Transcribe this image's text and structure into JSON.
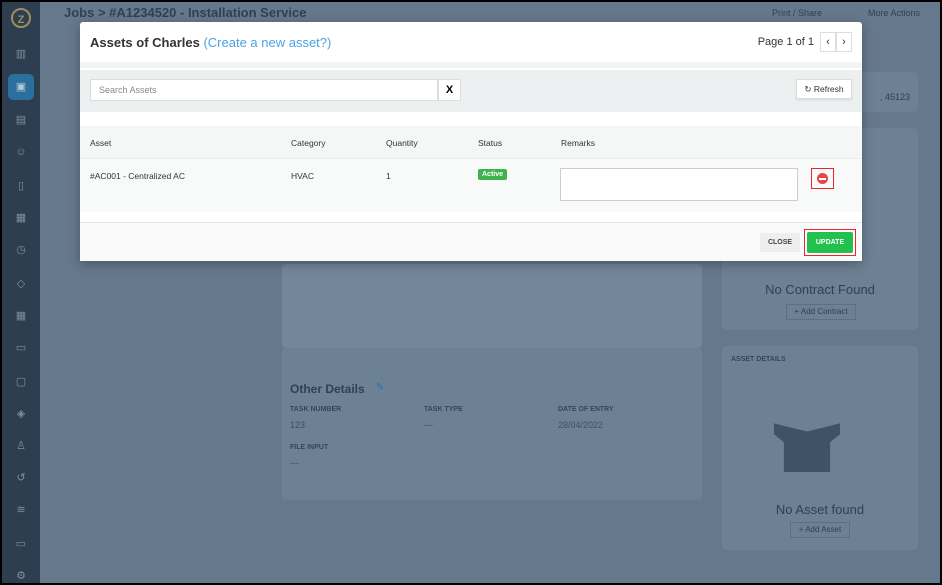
{
  "background": {
    "breadcrumb": "Jobs > #A1234520 - Installation Service",
    "print_share": "Print / Share",
    "more_actions": "More Actions",
    "address_fragment": ", 45123",
    "no_contract": "No Contract Found",
    "add_contract": "+ Add Contract",
    "asset_details_title": "ASSET DETAILS",
    "no_asset": "No Asset found",
    "add_asset": "+ Add Asset",
    "other_details": {
      "title": "Other Details",
      "fields": [
        {
          "label": "TASK NUMBER",
          "value": "123"
        },
        {
          "label": "TASK TYPE",
          "value": "---"
        },
        {
          "label": "DATE OF ENTRY",
          "value": "28/04/2022"
        },
        {
          "label": "FILE INPUT",
          "value": "---"
        }
      ]
    }
  },
  "modal": {
    "title": "Assets of Charles",
    "create_link": "(Create a new asset?)",
    "pager": "Page 1 of 1",
    "search_placeholder": "Search Assets",
    "clear": "X",
    "refresh": "Refresh",
    "columns": [
      "Asset",
      "Category",
      "Quantity",
      "Status",
      "Remarks"
    ],
    "rows": [
      {
        "asset": "#AC001 - Centralized AC",
        "category": "HVAC",
        "quantity": "1",
        "status": "Active",
        "remarks": ""
      }
    ],
    "close": "CLOSE",
    "update": "UPDATE"
  },
  "colors": {
    "accent": "#4aa3e0",
    "success": "#22c04c",
    "danger": "#e84545"
  }
}
